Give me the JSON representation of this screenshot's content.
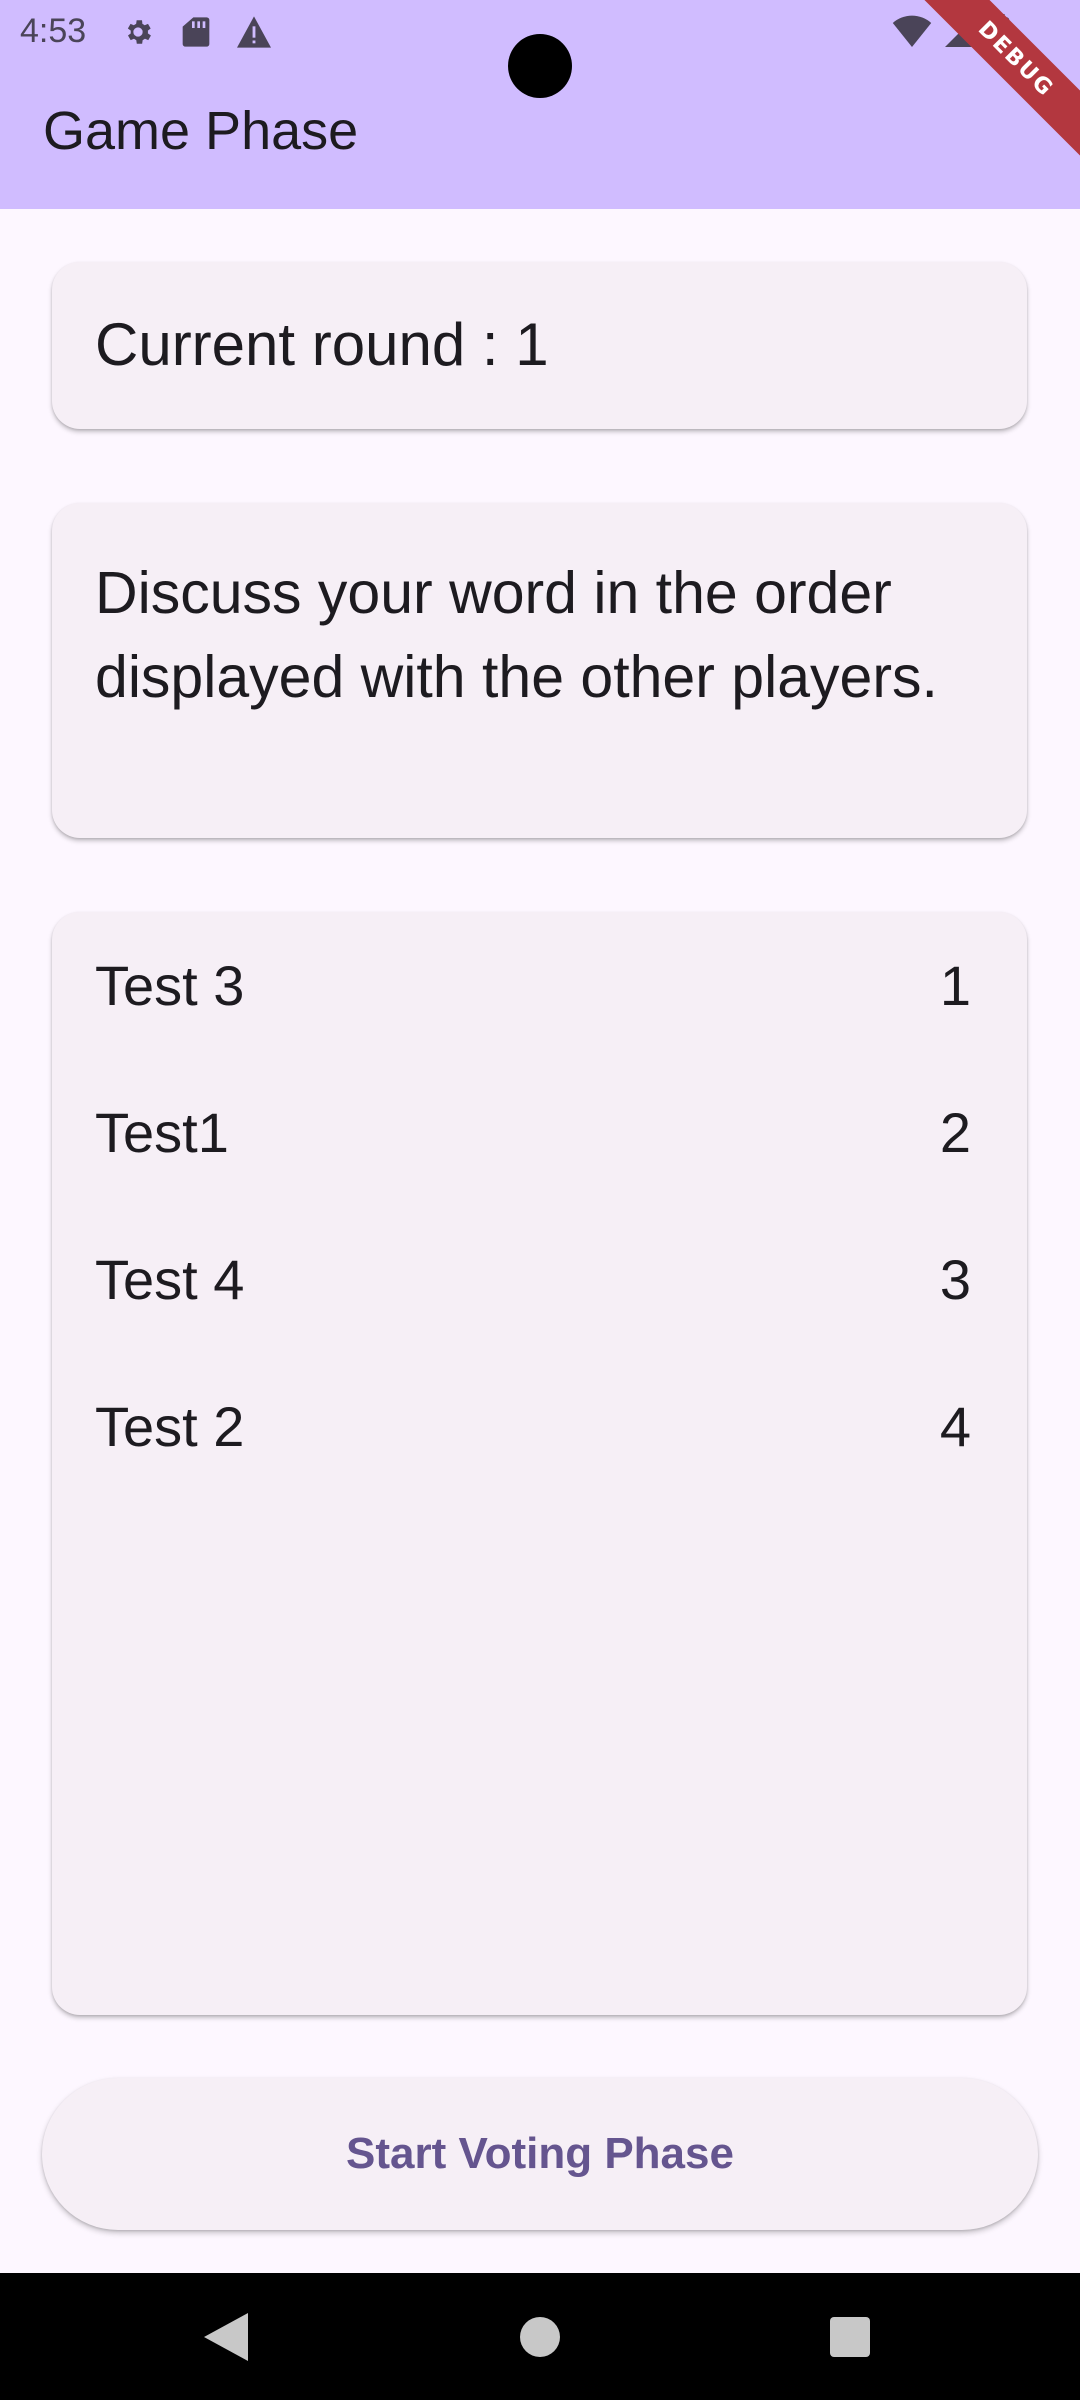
{
  "status_bar": {
    "time": "4:53",
    "left_icons": [
      "gear-icon",
      "sd-card-icon",
      "warning-icon"
    ],
    "right_icons": [
      "wifi-icon",
      "cell-signal-icon",
      "battery-icon"
    ]
  },
  "debug_banner": "DEBUG",
  "app_bar": {
    "title": "Game Phase"
  },
  "round": {
    "text": "Current round : 1"
  },
  "instructions": {
    "text": "Discuss your word in the order displayed with the other players."
  },
  "players": [
    {
      "name": "Test 3",
      "order": "1"
    },
    {
      "name": "Test1",
      "order": "2"
    },
    {
      "name": "Test 4",
      "order": "3"
    },
    {
      "name": "Test 2",
      "order": "4"
    }
  ],
  "action_button": {
    "label": "Start Voting Phase"
  },
  "nav_bar": {
    "icons": [
      "back-icon",
      "home-icon",
      "recents-icon"
    ]
  },
  "colors": {
    "app_bar": "#d0bcff",
    "background": "#fdf7ff",
    "card": "#f6eff6",
    "button_text": "#65558f",
    "debug_ribbon": "#b3373f"
  }
}
